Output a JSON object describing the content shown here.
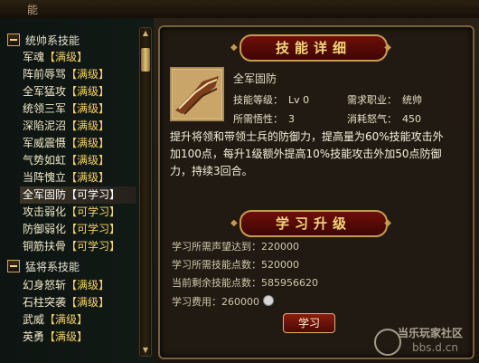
{
  "topbar": {
    "title": "能"
  },
  "left": {
    "groups": [
      {
        "label": "统帅系技能",
        "items": [
          {
            "name": "军魂",
            "status": "【满级】"
          },
          {
            "name": "阵前辱骂",
            "status": "【满级】"
          },
          {
            "name": "全军猛攻",
            "status": "【满级】"
          },
          {
            "name": "统领三军",
            "status": "【满级】"
          },
          {
            "name": "深陷泥沼",
            "status": "【满级】"
          },
          {
            "name": "军威震慑",
            "status": "【满级】"
          },
          {
            "name": "气势如虹",
            "status": "【满级】"
          },
          {
            "name": "当阵愧立",
            "status": "【满级】"
          },
          {
            "name": "全军固防",
            "status": "【可学习】"
          },
          {
            "name": "攻击弱化",
            "status": "【可学习】"
          },
          {
            "name": "防御弱化",
            "status": "【可学习】"
          },
          {
            "name": "铜筋扶骨",
            "status": "【可学习】"
          }
        ]
      },
      {
        "label": "猛将系技能",
        "items": [
          {
            "name": "幻身怒斩",
            "status": "【满级】"
          },
          {
            "name": "石柱突袭",
            "status": "【满级】"
          },
          {
            "name": "武威",
            "status": "【满级】"
          },
          {
            "name": "英勇",
            "status": "【满级】"
          }
        ]
      }
    ],
    "selected": 8
  },
  "detail": {
    "banner": "技能详细",
    "skill_name": "全军固防",
    "fields": {
      "level_label": "技能等级：",
      "level_value": "Lv 0",
      "job_label": "需求职业：",
      "job_value": "统帅",
      "wis_label": "所需悟性：",
      "wis_value": "3",
      "rage_label": "消耗怒气：",
      "rage_value": "450"
    },
    "description_lines": [
      "提升将领和带领士兵的防御力，提高量为60%技能攻击外",
      "加100点，每升1级额外提高10%技能攻击外加50点防御",
      "力，持续3回合。"
    ]
  },
  "learn": {
    "banner": "学习升级",
    "rows": [
      {
        "label": "学习所需声望达到：",
        "value": "220000"
      },
      {
        "label": "学习所需技能点数：",
        "value": "520000"
      },
      {
        "label": "当前剩余技能点数：",
        "value": "585956620"
      },
      {
        "label": "学习费用：",
        "value": "260000"
      }
    ],
    "button": "学习"
  },
  "watermark": {
    "line1": "当乐玩家社区",
    "line2": "bbs.d.cn"
  },
  "colors": {
    "accent": "#f3d77a",
    "status": "#f3d26a",
    "banner": "#6e0f0a"
  }
}
